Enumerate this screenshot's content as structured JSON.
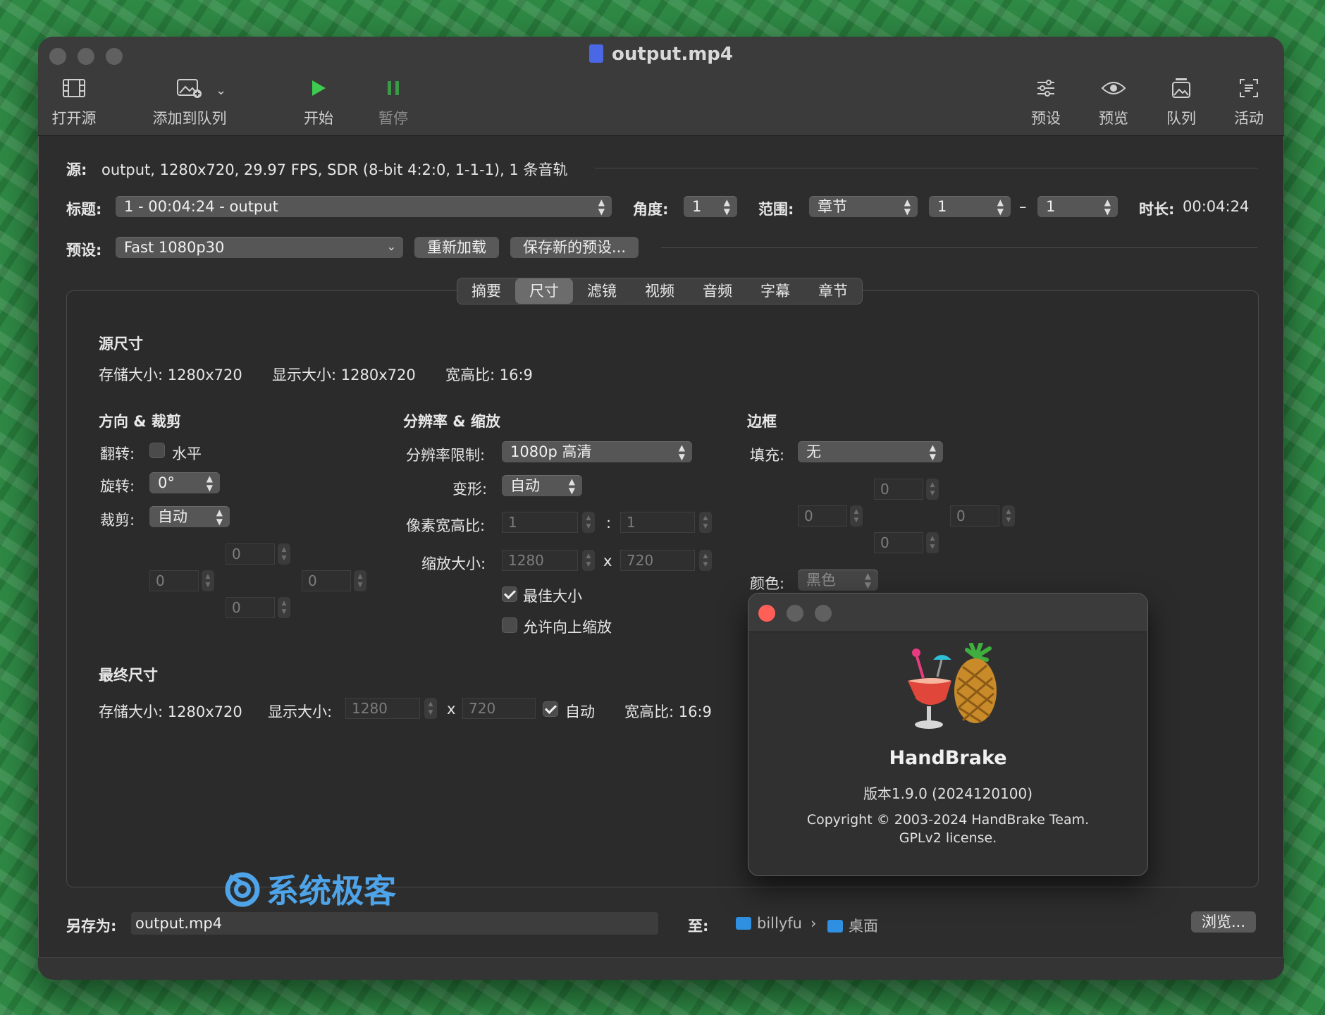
{
  "window": {
    "title": "output.mp4"
  },
  "toolbar": {
    "open_source": "打开源",
    "add_to_queue": "添加到队列",
    "start": "开始",
    "pause": "暂停",
    "presets": "预设",
    "preview": "预览",
    "queue": "队列",
    "activity": "活动"
  },
  "source": {
    "label": "源:",
    "value": "output, 1280x720, 29.97 FPS, SDR (8-bit 4:2:0, 1-1-1), 1 条音轨"
  },
  "title_row": {
    "label": "标题:",
    "value": "1 - 00:04:24 - output",
    "angle_label": "角度:",
    "angle_value": "1",
    "range_label": "范围:",
    "range_value": "章节",
    "range_start": "1",
    "range_dash": "–",
    "range_end": "1",
    "duration_label": "时长:",
    "duration_value": "00:04:24"
  },
  "preset_row": {
    "label": "预设:",
    "value": "Fast 1080p30",
    "reload": "重新加载",
    "save_new": "保存新的预设..."
  },
  "tabs": [
    "摘要",
    "尺寸",
    "滤镜",
    "视频",
    "音频",
    "字幕",
    "章节"
  ],
  "source_dims": {
    "heading": "源尺寸",
    "storage": "存储大小: 1280x720",
    "display": "显示大小: 1280x720",
    "aspect": "宽高比: 16:9"
  },
  "orientation": {
    "heading": "方向 & 裁剪",
    "flip_label": "翻转:",
    "flip_option": "水平",
    "rotate_label": "旋转:",
    "rotate_value": "0°",
    "crop_label": "裁剪:",
    "crop_value": "自动",
    "crop_top": "0",
    "crop_left": "0",
    "crop_right": "0",
    "crop_bottom": "0"
  },
  "resolution": {
    "heading": "分辨率 & 缩放",
    "limit_label": "分辨率限制:",
    "limit_value": "1080p 高清",
    "anamorphic_label": "变形:",
    "anamorphic_value": "自动",
    "par_label": "像素宽高比:",
    "par_w": "1",
    "par_sep": ":",
    "par_h": "1",
    "scale_label": "缩放大小:",
    "scale_w": "1280",
    "scale_sep": "x",
    "scale_h": "720",
    "best_size": "最佳大小",
    "allow_upscale": "允许向上缩放"
  },
  "borders": {
    "heading": "边框",
    "fill_label": "填充:",
    "fill_value": "无",
    "top": "0",
    "left": "0",
    "right": "0",
    "bottom": "0",
    "color_label": "颜色:",
    "color_value": "黑色"
  },
  "final_dims": {
    "heading": "最终尺寸",
    "storage": "存储大小: 1280x720",
    "display_label": "显示大小:",
    "display_w": "1280",
    "display_sep": "x",
    "display_h": "720",
    "auto": "自动",
    "aspect": "宽高比: 16:9"
  },
  "watermark": "系统极客",
  "about": {
    "app_name": "HandBrake",
    "version": "版本1.9.0 (2024120100)",
    "copyright": "Copyright © 2003-2024 HandBrake Team.",
    "license": "GPLv2 license."
  },
  "save": {
    "label": "另存为:",
    "filename": "output.mp4",
    "to_label": "至:",
    "path_user": "billyfu",
    "path_sep": "›",
    "path_folder": "桌面",
    "browse": "浏览..."
  },
  "colors": {
    "start_green": "#3ecb4f",
    "pause_green": "#3a9a48",
    "close_red": "#ff5f57",
    "folder_blue": "#2f8fe0"
  }
}
